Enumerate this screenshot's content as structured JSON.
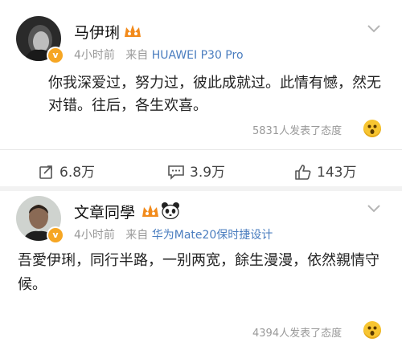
{
  "post1": {
    "author": "马伊琍",
    "time": "4小时前",
    "source_prefix": "来自",
    "source": "HUAWEI P30 Pro",
    "content": "你我深爱过，努力过，彼此成就过。此情有憾，然无对错。往后，各生欢喜。",
    "stat": "5831人发表了态度",
    "actions": {
      "repost": "6.8万",
      "comment": "3.9万",
      "like": "143万"
    }
  },
  "post2": {
    "author": "文章同學",
    "time": "4小时前",
    "source_prefix": "来自",
    "source": "华为Mate20保时捷设计",
    "content": "吾愛伊琍，同行半路，一别两宽，餘生漫漫，依然親情守候。",
    "stat": "4394人发表了态度"
  },
  "colors": {
    "source_link": "#4a7dbf",
    "vip_badge": "#f6a623",
    "crown": "#f28b1c",
    "muted_text": "#999999"
  }
}
